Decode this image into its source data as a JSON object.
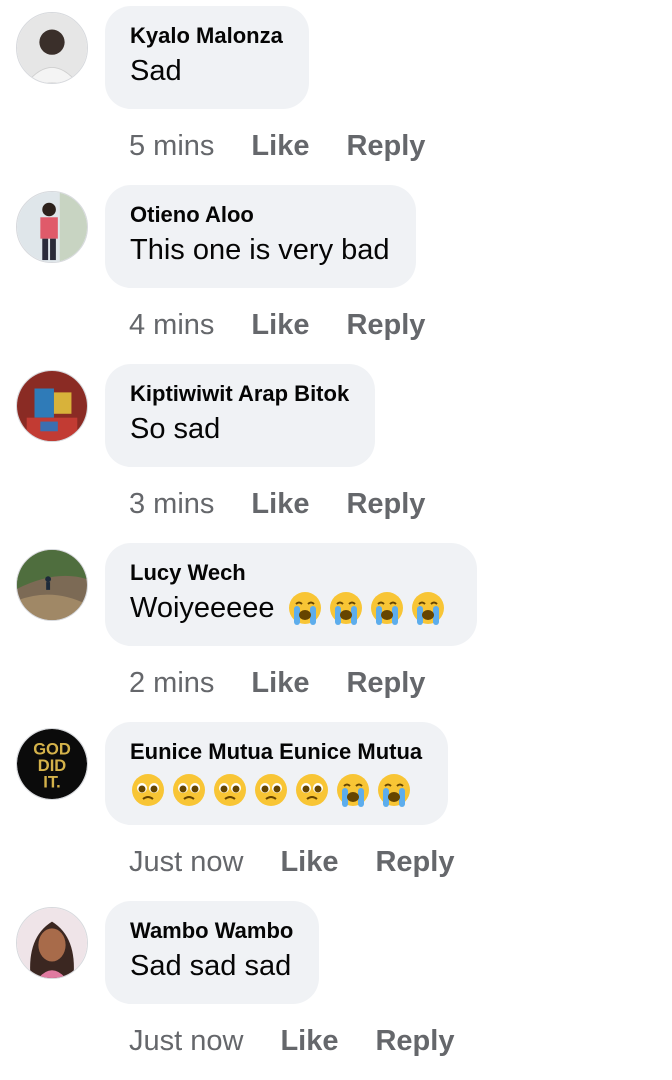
{
  "comments": [
    {
      "author": "Kyalo Malonza",
      "text": "Sad",
      "time": "5 mins",
      "like": "Like",
      "reply": "Reply",
      "emojis": []
    },
    {
      "author": "Otieno Aloo",
      "text": "This one is very bad",
      "time": "4 mins",
      "like": "Like",
      "reply": "Reply",
      "emojis": []
    },
    {
      "author": "Kiptiwiwit Arap Bitok",
      "text": "So sad",
      "time": "3 mins",
      "like": "Like",
      "reply": "Reply",
      "emojis": []
    },
    {
      "author": "Lucy Wech",
      "text": "Woiyeeeee",
      "time": "2 mins",
      "like": "Like",
      "reply": "Reply",
      "emojis": [
        "loudly-crying-face",
        "loudly-crying-face",
        "loudly-crying-face",
        "loudly-crying-face"
      ]
    },
    {
      "author": "Eunice Mutua Eunice Mutua",
      "text": "",
      "time": "Just now",
      "like": "Like",
      "reply": "Reply",
      "emojis": [
        "pleading-face",
        "pleading-face",
        "pleading-face",
        "pleading-face",
        "pleading-face",
        "loudly-crying-face",
        "loudly-crying-face"
      ]
    },
    {
      "author": "Wambo Wambo",
      "text": "Sad sad sad",
      "time": "Just now",
      "like": "Like",
      "reply": "Reply",
      "emojis": []
    }
  ],
  "avatar_logo_text": [
    "GOD",
    "DID",
    "IT."
  ],
  "colors": {
    "bubble": "#f0f2f5",
    "meta": "#65676b",
    "text": "#050505"
  }
}
